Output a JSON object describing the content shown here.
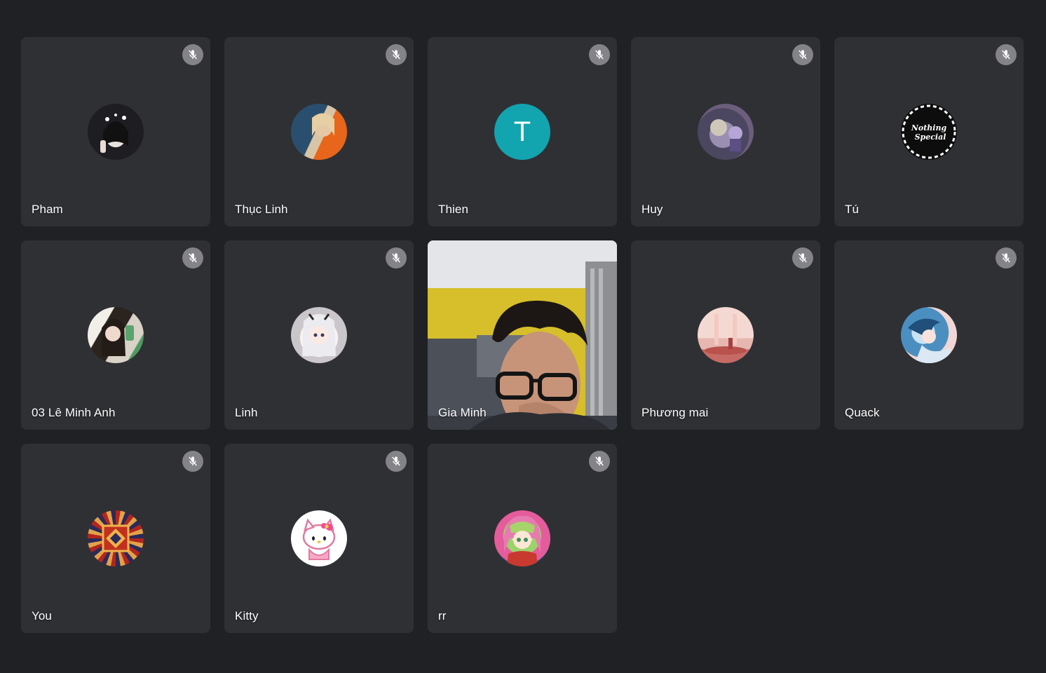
{
  "participants": [
    {
      "name": "Pham",
      "muted": true,
      "avatar": "photo-avatar"
    },
    {
      "name": "Thục Linh",
      "muted": true,
      "avatar": "photo-avatar"
    },
    {
      "name": "Thien",
      "muted": true,
      "avatar": "letter-avatar",
      "initial": "T",
      "avatar_color": "#12a4af"
    },
    {
      "name": "Huy",
      "muted": true,
      "avatar": "anime-avatar"
    },
    {
      "name": "Tú",
      "muted": true,
      "avatar": "nothing-special-logo",
      "logo_text": "Nothing Special"
    },
    {
      "name": "03 Lê Minh Anh",
      "muted": true,
      "avatar": "photo-avatar"
    },
    {
      "name": "Linh",
      "muted": true,
      "avatar": "anime-avatar"
    },
    {
      "name": "Gia Minh",
      "muted": false,
      "avatar": "live-video"
    },
    {
      "name": "Phương mai",
      "muted": true,
      "avatar": "illustration-avatar"
    },
    {
      "name": "Quack",
      "muted": true,
      "avatar": "illustration-avatar"
    },
    {
      "name": "You",
      "muted": true,
      "avatar": "pattern-avatar"
    },
    {
      "name": "Kitty",
      "muted": true,
      "avatar": "hello-kitty-avatar"
    },
    {
      "name": "rr",
      "muted": true,
      "avatar": "anime-avatar"
    }
  ],
  "colors": {
    "background": "#202124",
    "tile": "#2f3034",
    "mute_badge": "#a9aaad",
    "letter_avatar": "#12a4af"
  },
  "icons": {
    "mute": "mic-off-icon"
  }
}
